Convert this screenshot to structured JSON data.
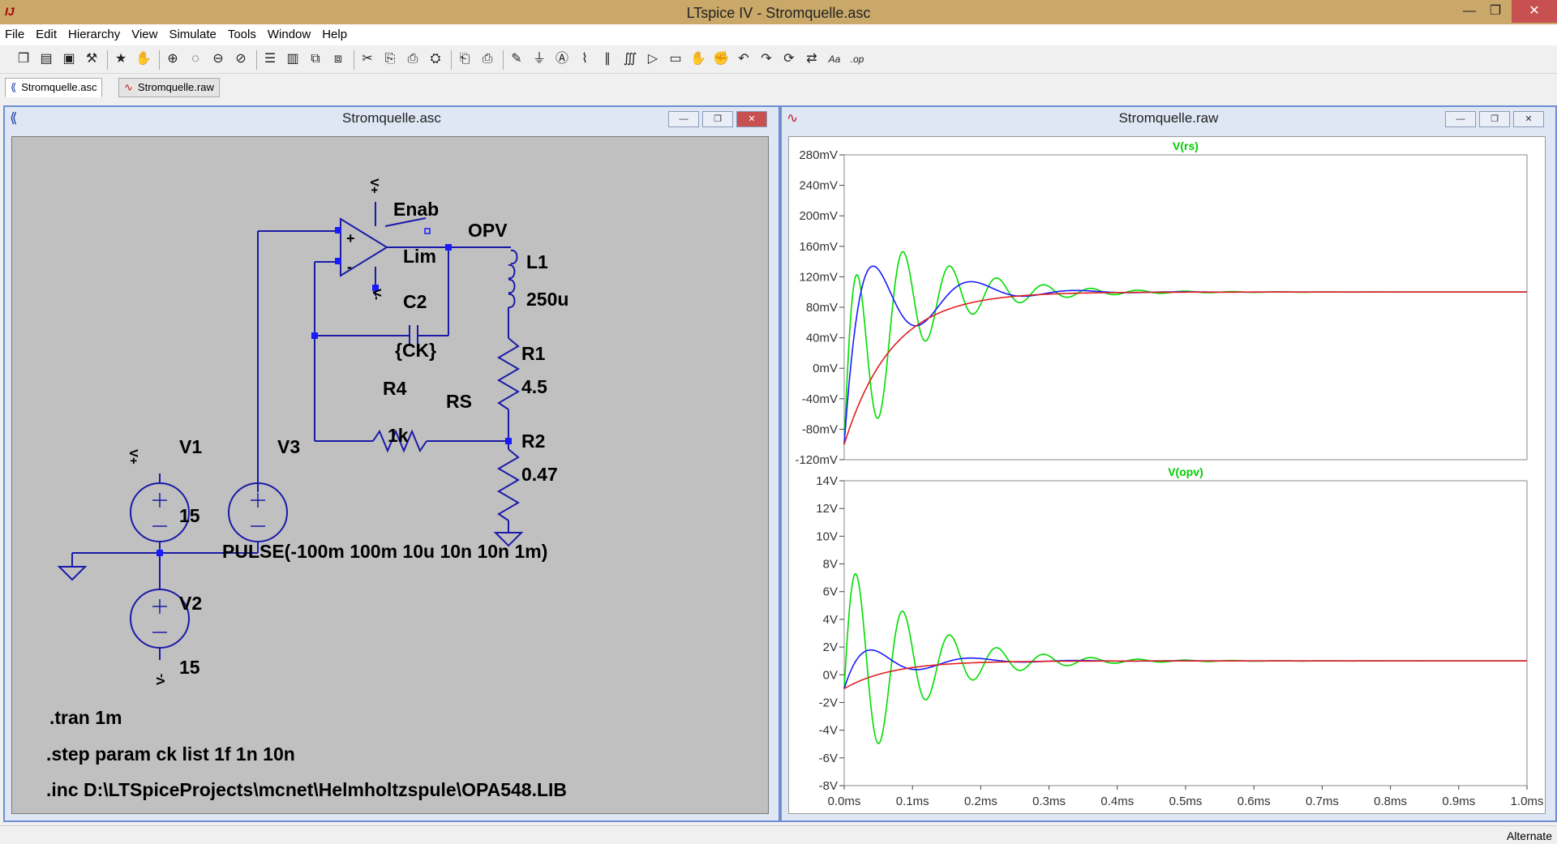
{
  "app": {
    "title": "LTspice IV - Stromquelle.asc"
  },
  "menu": [
    "File",
    "Edit",
    "Hierarchy",
    "View",
    "Simulate",
    "Tools",
    "Window",
    "Help"
  ],
  "toolbar_icons": [
    "new-schematic-icon",
    "open-icon",
    "save-icon",
    "control-panel-icon",
    "run-icon",
    "halt-icon",
    "zoom-in-icon",
    "zoom-back-icon",
    "zoom-out-icon",
    "zoom-fit-icon",
    "tile-horizontal-icon",
    "tile-vertical-icon",
    "cascade-icon",
    "close-all-icon",
    "cut-icon",
    "copy-icon",
    "paste-icon",
    "find-icon",
    "print-preview-icon",
    "print-icon",
    "wire-icon",
    "ground-icon",
    "label-icon",
    "resistor-icon",
    "capacitor-icon",
    "inductor-icon",
    "diode-icon",
    "component-icon",
    "move-icon",
    "drag-icon",
    "undo-icon",
    "redo-icon",
    "rotate-icon",
    "mirror-icon",
    "text-icon",
    "spice-directive-icon"
  ],
  "tabs": [
    {
      "label": "Stromquelle.asc",
      "active": true
    },
    {
      "label": "Stromquelle.raw",
      "active": false
    }
  ],
  "schematic": {
    "title": "Stromquelle.asc",
    "labels": {
      "enab": "Enab",
      "opv": "OPV",
      "lim": "Lim",
      "plus": "+",
      "minus": "-",
      "l1": "L1",
      "l1v": "250u",
      "c2": "C2",
      "ck": "{CK}",
      "r1": "R1",
      "r1v": "4.5",
      "r4": "R4",
      "r4v": "1k",
      "rs": "RS",
      "r2": "R2",
      "r2v": "0.47",
      "v1": "V1",
      "v1v": "15",
      "v2": "V2",
      "v2v": "15",
      "v3": "V3",
      "pulse": "PULSE(-100m 100m 10u 10n 10n 1m)",
      "vplus": "V+",
      "vminus": "V-"
    },
    "directives": [
      ".tran 1m",
      ".step param ck list 1f 1n 10n",
      ".inc D:\\LTSpiceProjects\\mcnet\\Helmholtzspule\\OPA548.LIB"
    ]
  },
  "waveform": {
    "title": "Stromquelle.raw",
    "xticks": [
      "0.0ms",
      "0.1ms",
      "0.2ms",
      "0.3ms",
      "0.4ms",
      "0.5ms",
      "0.6ms",
      "0.7ms",
      "0.8ms",
      "0.9ms",
      "1.0ms"
    ]
  },
  "chart_data": [
    {
      "type": "line",
      "title": "V(rs)",
      "yunit": "mV",
      "ylim": [
        -120,
        280
      ],
      "yticks": [
        "280mV",
        "240mV",
        "200mV",
        "160mV",
        "120mV",
        "80mV",
        "40mV",
        "0mV",
        "-40mV",
        "-80mV",
        "-120mV"
      ],
      "xlim": [
        0,
        1.0
      ],
      "xunit": "ms",
      "series": [
        {
          "color": "#00dd00",
          "kind": "damped",
          "start": -100,
          "final": 100,
          "amp": 360,
          "freq_per_ms": 14.5,
          "tau_ms": 0.1
        },
        {
          "color": "#1a1aff",
          "kind": "damped",
          "start": -100,
          "final": 100,
          "amp": 300,
          "freq_per_ms": 6.5,
          "tau_ms": 0.08
        },
        {
          "color": "#e02020",
          "kind": "rc",
          "start": -100,
          "final": 100,
          "tau_ms": 0.07
        }
      ]
    },
    {
      "type": "line",
      "title": "V(opv)",
      "yunit": "V",
      "ylim": [
        -8,
        14
      ],
      "yticks": [
        "14V",
        "12V",
        "10V",
        "8V",
        "6V",
        "4V",
        "2V",
        "0V",
        "-2V",
        "-4V",
        "-6V",
        "-8V"
      ],
      "xlim": [
        0,
        1.0
      ],
      "xunit": "ms",
      "series": [
        {
          "color": "#00dd00",
          "kind": "damped",
          "start": -1,
          "final": 1,
          "amp": 18,
          "freq_per_ms": 14.5,
          "tau_ms": 0.1
        },
        {
          "color": "#1a1aff",
          "kind": "damped",
          "start": -1,
          "final": 1,
          "amp": 4.5,
          "freq_per_ms": 6.5,
          "tau_ms": 0.08
        },
        {
          "color": "#e02020",
          "kind": "rc",
          "start": -1,
          "final": 1,
          "tau_ms": 0.07
        }
      ]
    }
  ],
  "status": {
    "text": "Alternate"
  }
}
